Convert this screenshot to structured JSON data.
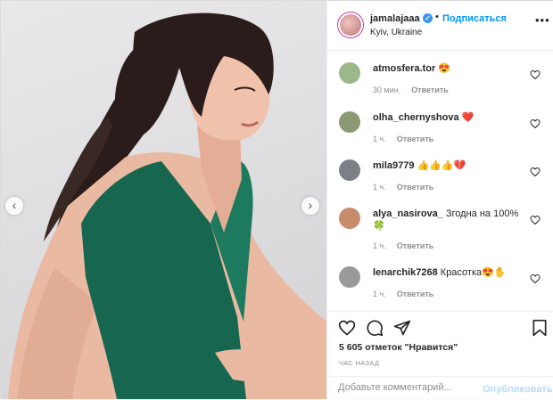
{
  "post": {
    "username": "jamalajaaa",
    "location": "Kyiv, Ukraine",
    "separator": "•",
    "follow_label": "Подписаться",
    "more_label": "•••",
    "verified_glyph": "✓",
    "prev_glyph": "‹",
    "next_glyph": "›"
  },
  "comments": [
    {
      "username": "atmosfera.tor",
      "text": "😍",
      "time": "30 мин.",
      "reply": "Ответить",
      "avatar_color": "#9bb88a"
    },
    {
      "username": "olha_chernyshova",
      "text": "❤️",
      "time": "1 ч.",
      "reply": "Ответить",
      "avatar_color": "#8c9a73"
    },
    {
      "username": "mila9779",
      "text": "👍👍👍💔",
      "time": "1 ч.",
      "reply": "Ответить",
      "avatar_color": "#7c7f86"
    },
    {
      "username": "alya_nasirova_",
      "text": "Згодна на 100% 🍀",
      "time": "1 ч.",
      "reply": "Ответить",
      "avatar_color": "#c98c6a"
    },
    {
      "username": "lenarchik7268",
      "text": "Красотка😍✋",
      "time": "1 ч.",
      "reply": "Ответить",
      "avatar_color": "#9a9a9a"
    }
  ],
  "actions": {
    "likes": "5 605 отметок \"Нравится\"",
    "time_ago": "час назад",
    "comment_placeholder": "Добавьте комментарий...",
    "publish_label": "Опубликовать"
  },
  "icons": {
    "like": "heart-icon",
    "comment": "comment-icon",
    "share": "share-icon",
    "save": "bookmark-icon"
  },
  "colors": {
    "accent": "#0095f6",
    "publish_disabled": "#b3dbff",
    "dress": "#17664f",
    "hair": "#2a1c1a"
  }
}
